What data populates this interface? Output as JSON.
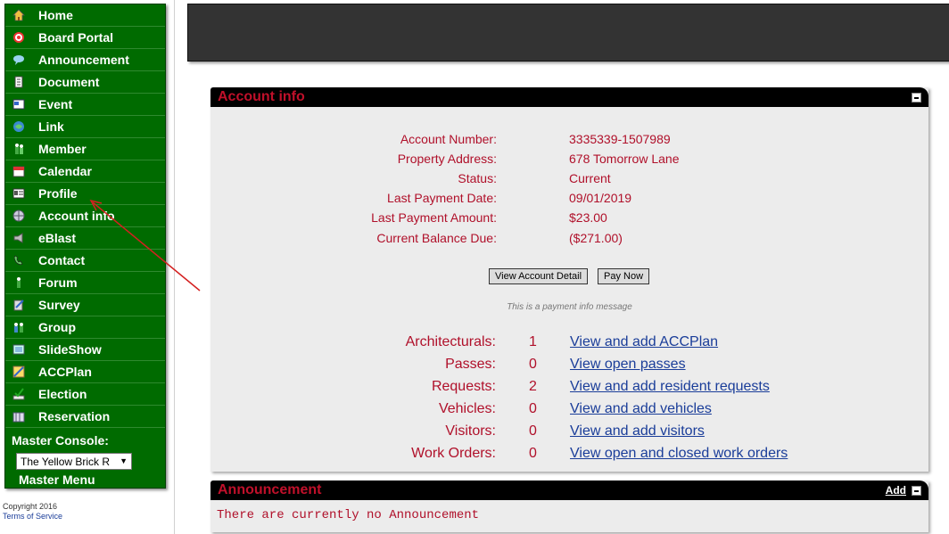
{
  "sidebar": {
    "items": [
      {
        "label": "Home",
        "icon": "home-icon"
      },
      {
        "label": "Board Portal",
        "icon": "target-icon"
      },
      {
        "label": "Announcement",
        "icon": "speech-bubble-icon"
      },
      {
        "label": "Document",
        "icon": "document-icon"
      },
      {
        "label": "Event",
        "icon": "event-icon"
      },
      {
        "label": "Link",
        "icon": "link-icon"
      },
      {
        "label": "Member",
        "icon": "members-icon"
      },
      {
        "label": "Calendar",
        "icon": "calendar-icon"
      },
      {
        "label": "Profile",
        "icon": "profile-card-icon"
      },
      {
        "label": "Account info",
        "icon": "globe-icon"
      },
      {
        "label": "eBlast",
        "icon": "megaphone-icon"
      },
      {
        "label": "Contact",
        "icon": "phone-icon"
      },
      {
        "label": "Forum",
        "icon": "person-icon"
      },
      {
        "label": "Survey",
        "icon": "survey-icon"
      },
      {
        "label": "Group",
        "icon": "group-icon"
      },
      {
        "label": "SlideShow",
        "icon": "slideshow-icon"
      },
      {
        "label": "ACCPlan",
        "icon": "ruler-icon"
      },
      {
        "label": "Election",
        "icon": "checkmark-icon"
      },
      {
        "label": "Reservation",
        "icon": "reservation-icon"
      }
    ],
    "console_label": "Master Console:",
    "console_selected": "The Yellow Brick R",
    "master_menu": "Master Menu"
  },
  "footer": {
    "copyright": "Copyright 2016",
    "terms": "Terms of Service"
  },
  "account_panel": {
    "title": "Account info",
    "fields": [
      {
        "label": "Account Number:",
        "value": "3335339-1507989"
      },
      {
        "label": "Property Address:",
        "value": "678 Tomorrow Lane"
      },
      {
        "label": "Status:",
        "value": "Current"
      },
      {
        "label": "Last Payment Date:",
        "value": "09/01/2019"
      },
      {
        "label": "Last Payment Amount:",
        "value": "$23.00"
      },
      {
        "label": "Current Balance Due:",
        "value": "($271.00)"
      }
    ],
    "view_detail_button": "View Account Detail",
    "pay_now_button": "Pay Now",
    "info_message": "This is a payment info message",
    "summary": [
      {
        "label": "Architecturals:",
        "count": "1",
        "link": "View and add ACCPlan"
      },
      {
        "label": "Passes:",
        "count": "0",
        "link": "View open passes"
      },
      {
        "label": "Requests:",
        "count": "2",
        "link": "View and add resident requests"
      },
      {
        "label": "Vehicles:",
        "count": "0",
        "link": "View and add vehicles"
      },
      {
        "label": "Visitors:",
        "count": "0",
        "link": "View and add visitors"
      },
      {
        "label": "Work Orders:",
        "count": "0",
        "link": "View open and closed work orders"
      }
    ]
  },
  "announcement_panel": {
    "title": "Announcement",
    "add_link": "Add",
    "empty_message": "There are currently no Announcement"
  },
  "colors": {
    "sidebar_bg": "#006b00",
    "accent_red": "#b0102a",
    "link_blue": "#1a3d99",
    "annotation_arrow": "#d42020"
  }
}
